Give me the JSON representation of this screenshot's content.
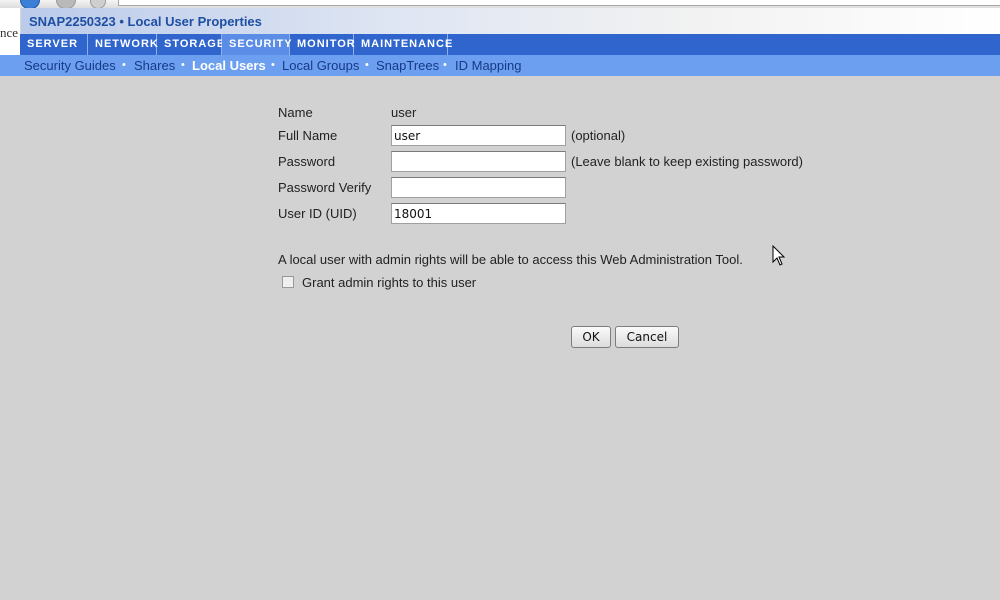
{
  "window": {
    "logo_text": "nce",
    "title": "SNAP2250323 • Local User Properties"
  },
  "main_nav": {
    "tabs": [
      {
        "label": "SERVER"
      },
      {
        "label": "NETWORK"
      },
      {
        "label": "STORAGE"
      },
      {
        "label": "SECURITY",
        "active": true
      },
      {
        "label": "MONITOR"
      },
      {
        "label": "MAINTENANCE"
      }
    ]
  },
  "sub_nav": {
    "separator": "•",
    "items": [
      {
        "label": "Security Guides"
      },
      {
        "label": "Shares"
      },
      {
        "label": "Local Users",
        "active": true
      },
      {
        "label": "Local Groups"
      },
      {
        "label": "SnapTrees"
      },
      {
        "label": "ID Mapping"
      }
    ]
  },
  "form": {
    "name_label": "Name",
    "name_value": "user",
    "full_name_label": "Full Name",
    "full_name_value": "user",
    "full_name_hint": "(optional)",
    "password_label": "Password",
    "password_value": "",
    "password_hint": "(Leave blank to keep existing password)",
    "password_verify_label": "Password Verify",
    "password_verify_value": "",
    "uid_label": "User ID (UID)",
    "uid_value": "18001",
    "admin_note": "A local user with admin rights will be able to access this Web Administration Tool.",
    "grant_admin_label": "Grant admin rights to this user",
    "grant_admin_checked": false
  },
  "buttons": {
    "ok_label": "OK",
    "cancel_label": "Cancel"
  },
  "colors": {
    "main_nav_bg": "#2f65cc",
    "main_nav_active": "#5b8ce6",
    "sub_nav_bg": "#6d9ff0",
    "title_color": "#1f4fa3",
    "page_bg": "#d2d2d2"
  }
}
